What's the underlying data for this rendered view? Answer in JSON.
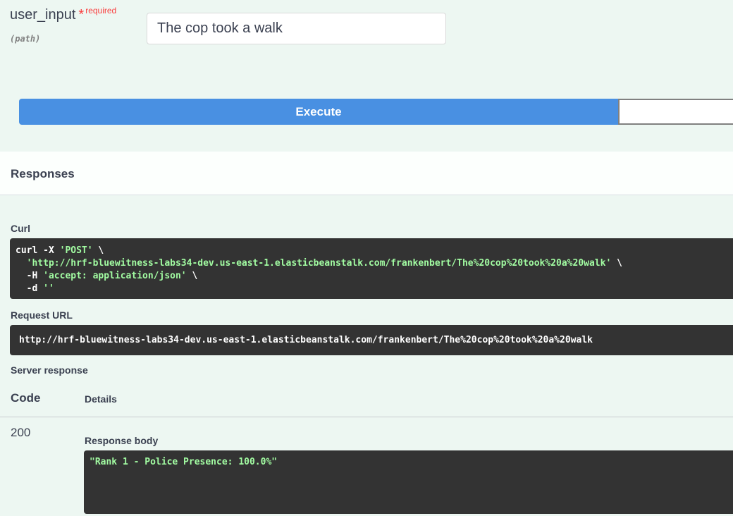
{
  "parameter": {
    "name": "user_input",
    "required_star": "*",
    "required_label": "required",
    "location": "(path)",
    "value": "The cop took a walk"
  },
  "actions": {
    "execute_label": "Execute"
  },
  "responses": {
    "title": "Responses",
    "curl_label": "Curl",
    "curl": {
      "line1_cmd": "curl -X ",
      "line1_method": "'POST'",
      "line1_end": " \\",
      "line2_indent": "  ",
      "line2_url": "'http://hrf-bluewitness-labs34-dev.us-east-1.elasticbeanstalk.com/frankenbert/The%20cop%20took%20a%20walk'",
      "line2_end": " \\",
      "line3_flag": "  -H ",
      "line3_header": "'accept: application/json'",
      "line3_end": " \\",
      "line4_flag": "  -d ",
      "line4_data": "''"
    },
    "request_url_label": "Request URL",
    "request_url": "http://hrf-bluewitness-labs34-dev.us-east-1.elasticbeanstalk.com/frankenbert/The%20cop%20took%20a%20walk",
    "server_response_label": "Server response",
    "table": {
      "code_header": "Code",
      "details_header": "Details"
    },
    "status_code": "200",
    "response_body_label": "Response body",
    "response_body": "\"Rank 1 - Police Presence: 100.0%\""
  },
  "colors": {
    "background": "#edf7f2",
    "execute": "#4990e2",
    "required": "#f93e3e",
    "code_bg": "#333333",
    "code_string": "#a2fca2"
  }
}
